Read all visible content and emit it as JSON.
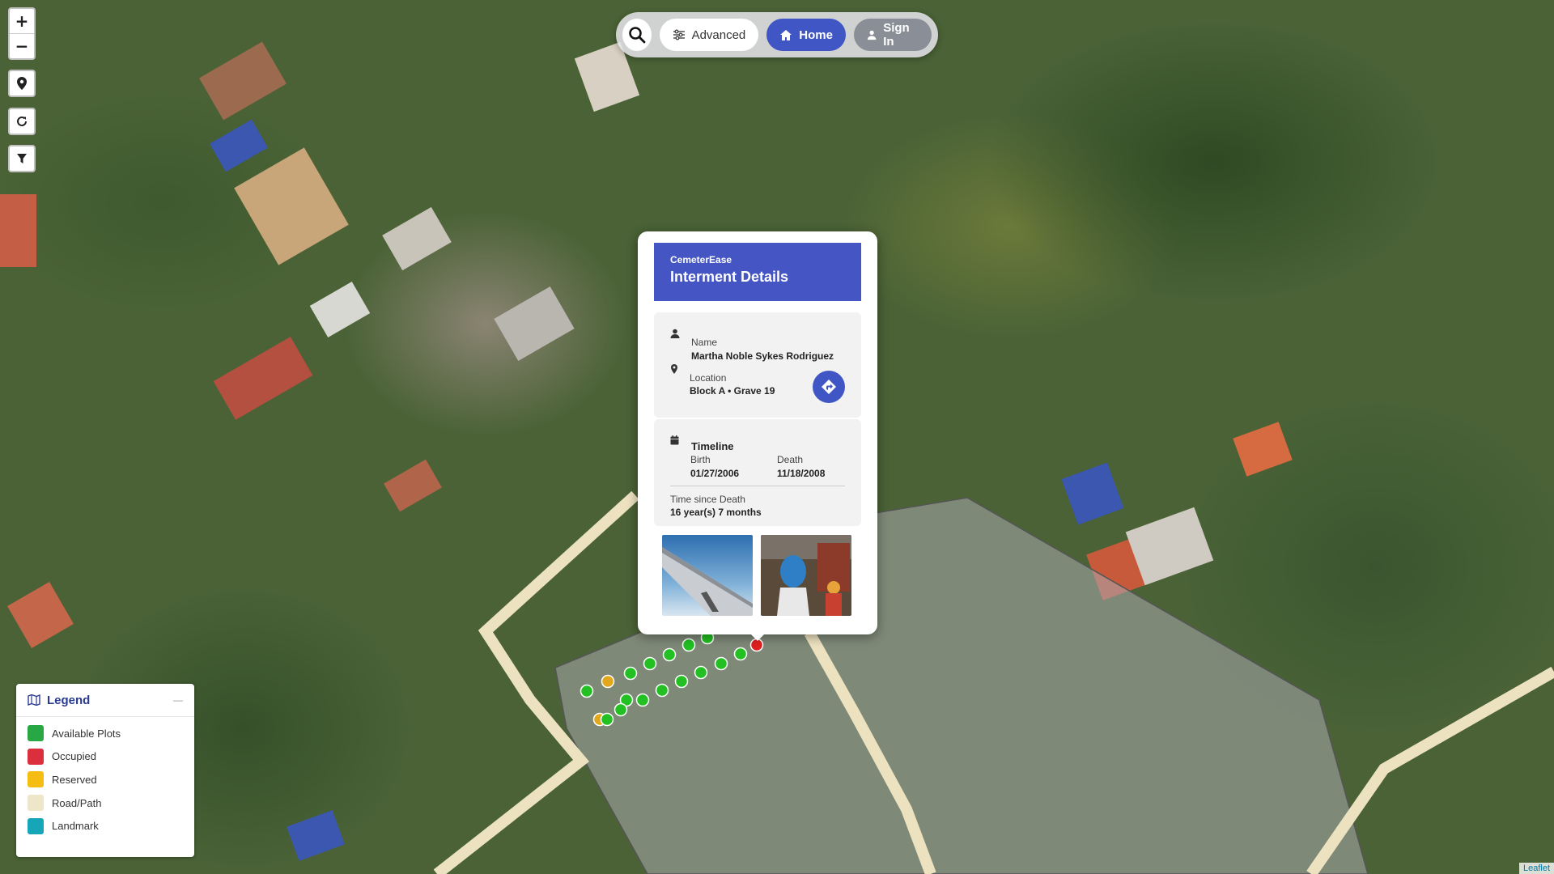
{
  "map": {
    "attribution": "Leaflet",
    "plots": [
      {
        "status": "available"
      },
      {
        "status": "available"
      },
      {
        "status": "available"
      },
      {
        "status": "available"
      },
      {
        "status": "available"
      },
      {
        "status": "occupied"
      },
      {
        "status": "available"
      },
      {
        "status": "available"
      },
      {
        "status": "available"
      },
      {
        "status": "available"
      },
      {
        "status": "available"
      },
      {
        "status": "available"
      },
      {
        "status": "reserved"
      },
      {
        "status": "available"
      },
      {
        "status": "available"
      },
      {
        "status": "reserved"
      },
      {
        "status": "available"
      },
      {
        "status": "available"
      }
    ]
  },
  "controls": {
    "zoom_in": "+",
    "zoom_out": "−",
    "locate_icon": "map-pin-icon",
    "refresh_icon": "refresh-icon",
    "filter_icon": "filter-icon"
  },
  "toolbar": {
    "search_icon": "search-icon",
    "advanced_label": "Advanced",
    "home_label": "Home",
    "signin_label": "Sign In"
  },
  "popup": {
    "brand": "CemeterEase",
    "title": "Interment Details",
    "name_label": "Name",
    "name_value": "Martha Noble Sykes Rodriguez",
    "location_label": "Location",
    "location_value": "Block A • Grave 19",
    "timeline_label": "Timeline",
    "birth_label": "Birth",
    "birth_value": "01/27/2006",
    "death_label": "Death",
    "death_value": "11/18/2008",
    "since_label": "Time since Death",
    "since_value": "16 year(s) 7 months"
  },
  "legend": {
    "title": "Legend",
    "collapse": "—",
    "items": [
      {
        "label": "Available Plots",
        "color": "#27a844"
      },
      {
        "label": "Occupied",
        "color": "#dc2f3e"
      },
      {
        "label": "Reserved",
        "color": "#f5bd12"
      },
      {
        "label": "Road/Path",
        "color": "#ede6c8"
      },
      {
        "label": "Landmark",
        "color": "#16a6b8"
      }
    ]
  },
  "colors": {
    "accent": "#3f56c4",
    "available": "#22c022",
    "occupied": "#e02020",
    "reserved": "#e0a81a",
    "road": "#ede2c0"
  }
}
